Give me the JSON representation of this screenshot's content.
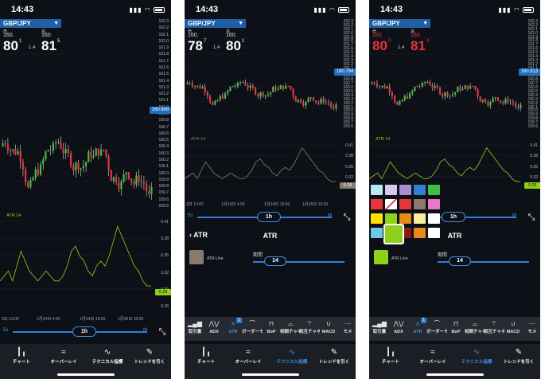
{
  "status": {
    "time": "14:43"
  },
  "pair": "GBP/JPY",
  "screens": [
    {
      "quote": {
        "bid_label": "売",
        "ask_label": "買",
        "bid_small": "160.",
        "ask_small": "160.",
        "bid_big": "80",
        "bid_sup": "1",
        "ask_big": "81",
        "ask_sup": "5",
        "spread": "1.4"
      },
      "price_tag": "160.808",
      "y_ticks": [
        "162.3",
        "162.2",
        "162.1",
        "162.0",
        "161.9",
        "161.8",
        "161.7",
        "161.6",
        "161.5",
        "161.4",
        "161.3",
        "161.2",
        "161.1",
        "161.0",
        "160.9",
        "160.8",
        "160.7",
        "160.6",
        "160.5",
        "160.4",
        "160.3",
        "160.2",
        "160.1",
        "160.0",
        "159.9",
        "159.8",
        "159.7",
        "159.6",
        "159.5"
      ],
      "indicator_label": "ATR 14",
      "ind_ticks": [
        "0.41",
        "0.38",
        "0.35",
        "0.32",
        "0.29",
        "0.26"
      ],
      "ind_tag": "0.29",
      "x_ticks": [
        "3日 13:00",
        "1月24日 4:00",
        "1月24日 19:00",
        "1月25日 10:00"
      ],
      "timeframe": {
        "min": "5s",
        "value": "1h",
        "max": "M"
      }
    },
    {
      "quote": {
        "bid_label": "売",
        "ask_label": "買",
        "bid_small": "160.",
        "ask_small": "160.",
        "bid_big": "78",
        "bid_sup": "7",
        "ask_big": "80",
        "ask_sup": "1",
        "spread": "1.4"
      },
      "price_tag": "160.794",
      "y_ticks": [
        "162.3",
        "162.2",
        "162.1",
        "162.0",
        "161.9",
        "161.8",
        "161.7",
        "161.6",
        "161.5",
        "161.4",
        "161.3",
        "161.2",
        "161.1",
        "161.0",
        "160.9",
        "160.8",
        "160.7",
        "160.6",
        "160.5",
        "160.4",
        "160.3",
        "160.2",
        "160.1",
        "160.0",
        "159.9",
        "159.8",
        "159.7",
        "159.6"
      ],
      "indicator_label": "ATR 14",
      "ind_ticks": [
        "0.41",
        "0.38",
        "0.35",
        "0.32",
        "0.29"
      ],
      "ind_tag": "0.29",
      "x_ticks": [
        "3日 13:00",
        "1月24日 4:00",
        "1月24日 19:00",
        "1月25日 10:00"
      ],
      "timeframe": {
        "min": "5s",
        "value": "1h",
        "max": "M"
      },
      "settings": {
        "back": "ATR",
        "title": "ATR",
        "line_label": "ATR Line",
        "period_label": "期間",
        "period_value": "14",
        "line_color": "#8a7a6e"
      }
    },
    {
      "quote": {
        "bid_label": "売",
        "ask_label": "買",
        "bid_small": "160.",
        "ask_small": "160.",
        "bid_big": "80",
        "bid_sup": "0",
        "ask_big": "81",
        "ask_sup": "4",
        "spread": "1.4"
      },
      "price_tag": "160.813",
      "y_ticks": [
        "162.3",
        "162.2",
        "162.1",
        "162.0",
        "161.9",
        "161.8",
        "161.7",
        "161.6",
        "161.5",
        "161.4",
        "161.3",
        "161.2",
        "161.1",
        "161.0",
        "160.9",
        "160.8",
        "160.7",
        "160.6",
        "160.5",
        "160.4",
        "160.3",
        "160.2",
        "160.1",
        "160.0",
        "159.9",
        "159.8",
        "159.7",
        "159.6"
      ],
      "indicator_label": "ATR 14",
      "ind_ticks": [
        "0.41",
        "0.38",
        "0.35",
        "0.32",
        "0.29"
      ],
      "ind_tag": "0.29",
      "x_ticks": [
        "3日 13:00",
        "1月24日 4:00",
        "1月24日 19:00",
        "1月25日 10:00"
      ],
      "timeframe": {
        "min": "5s",
        "value": "1h",
        "max": "M"
      },
      "settings": {
        "back": "",
        "title": "ATR",
        "line_label": "ATR Line",
        "period_label": "期間",
        "period_value": "14",
        "line_color": "#8fd11a"
      }
    }
  ],
  "indicator_tabs": [
    "取引量",
    "ADX",
    "ATR",
    "ボーダーモメンタム",
    "BoP",
    "相関チャネル/CMO",
    "相互チャネル指標 アルティメット",
    "MACD",
    "モメ"
  ],
  "bottom_nav": [
    "チャート",
    "オーバーレイ",
    "テクニカル指標",
    "トレンドを引く"
  ],
  "colors": {
    "accent": "#2f7fd8",
    "up": "#3fbf3f",
    "down": "#e8343c",
    "atr_green": "#8fd11a",
    "atr_brown": "#8a7a6e"
  },
  "palette": [
    "#b6e8f5",
    "#d8c8ef",
    "#a98bd3",
    "#2f7fd8",
    "#3fbf3f",
    "#e8343c",
    "#ffffff",
    "#e8343c",
    "#8a7a6e",
    "#e878c8",
    "#ffe000",
    "#8fd11a",
    "#e88a1a",
    "#f5f0a0",
    "#ffffff",
    "#6fc8e8",
    "#e8343c",
    "#8a1a1a",
    "#e88a1a",
    "#ffffff"
  ]
}
